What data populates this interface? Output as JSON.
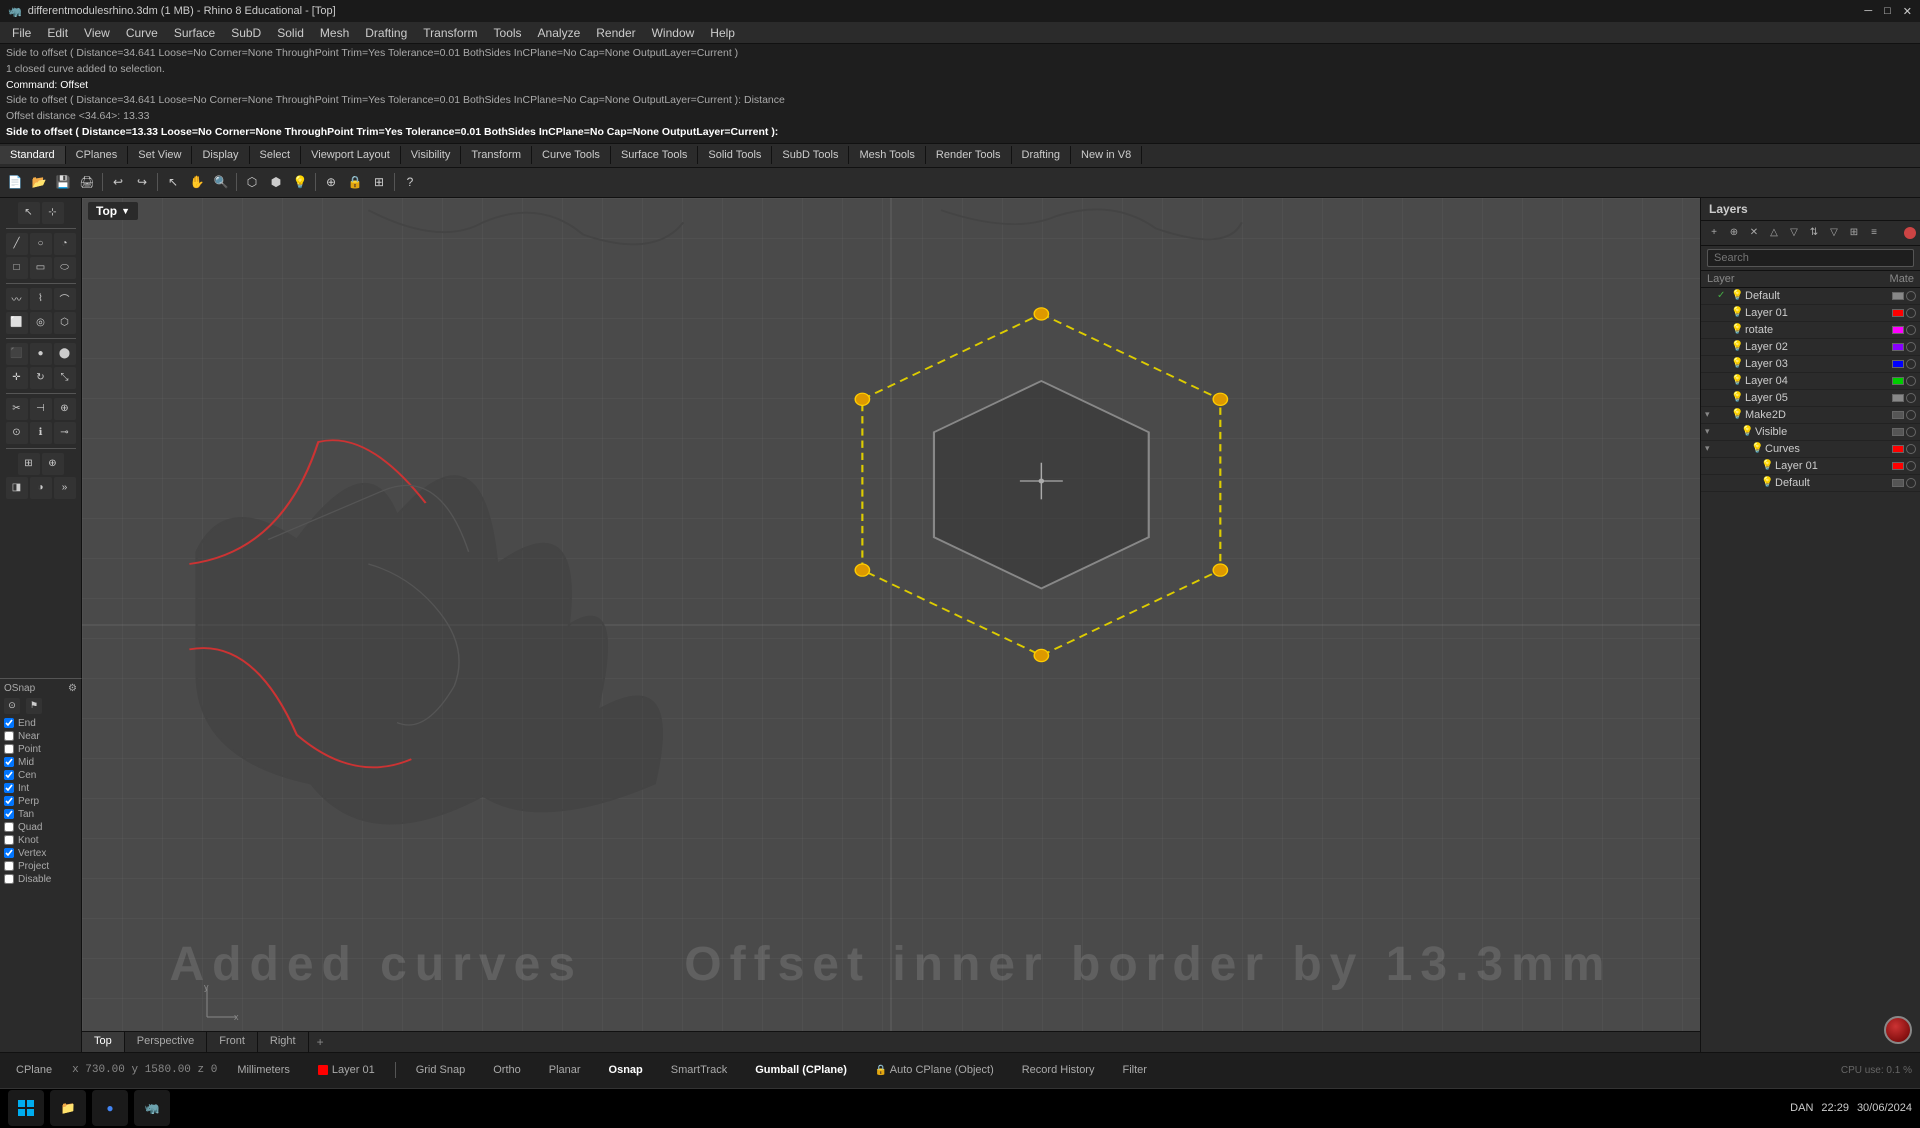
{
  "titlebar": {
    "title": "differentmodulesrhino.3dm (1 MB) - Rhino 8 Educational - [Top]",
    "icon": "🦏",
    "minimize": "─",
    "maximize": "□",
    "close": "✕"
  },
  "menu": {
    "items": [
      "File",
      "Edit",
      "View",
      "Curve",
      "Surface",
      "SubD",
      "Solid",
      "Mesh",
      "Drafting",
      "Transform",
      "Tools",
      "Analyze",
      "Render",
      "Window",
      "Help"
    ]
  },
  "command_area": {
    "line1": "Side to offset ( Distance=34.641  Loose=No  Corner=None  ThroughPoint  Trim=Yes  Tolerance=0.01  BothSides  InCPlane=No  Cap=None  OutputLayer=Current )",
    "line2": "1 closed curve added to selection.",
    "line3": "Command: Offset",
    "line4": "Side to offset ( Distance=34.641  Loose=No  Corner=None  ThroughPoint  Trim=Yes  Tolerance=0.01  BothSides  InCPlane=No  Cap=None  OutputLayer=Current ): Distance",
    "line5": "Offset distance <34.64>: 13.33",
    "line6": "Side to offset ( Distance=13.33  Loose=No  Corner=None  ThroughPoint  Trim=Yes  Tolerance=0.01  BothSides  InCPlane=No  Cap=None  OutputLayer=Current ):"
  },
  "toolbar_tabs": {
    "items": [
      "Standard",
      "CPlanes",
      "Set View",
      "Display",
      "Select",
      "Viewport Layout",
      "Visibility",
      "Transform",
      "Curve Tools",
      "Surface Tools",
      "Solid Tools",
      "SubD Tools",
      "Mesh Tools",
      "Render Tools",
      "Drafting",
      "New in V8"
    ]
  },
  "viewport": {
    "label": "Top",
    "watermark_left": "Added curves",
    "watermark_right": "Offset inner border by 13.3mm"
  },
  "view_tabs": {
    "items": [
      "Top",
      "Perspective",
      "Front",
      "Right"
    ],
    "active": "Top"
  },
  "layers_panel": {
    "title": "Layers",
    "search_placeholder": "Search",
    "col_layer": "Layer",
    "col_mate": "Mate",
    "layers": [
      {
        "name": "Default",
        "indent": 0,
        "checked": true,
        "color": "#888",
        "visible": true
      },
      {
        "name": "Layer 01",
        "indent": 0,
        "checked": false,
        "color": "#ff0000",
        "visible": true
      },
      {
        "name": "rotate",
        "indent": 0,
        "checked": false,
        "color": "#ff00ff",
        "visible": true
      },
      {
        "name": "Layer 02",
        "indent": 0,
        "checked": false,
        "color": "#8800ff",
        "visible": true
      },
      {
        "name": "Layer 03",
        "indent": 0,
        "checked": false,
        "color": "#0000ff",
        "visible": true
      },
      {
        "name": "Layer 04",
        "indent": 0,
        "checked": false,
        "color": "#00cc00",
        "visible": true
      },
      {
        "name": "Layer 05",
        "indent": 0,
        "checked": false,
        "color": "#888888",
        "visible": true
      },
      {
        "name": "Make2D",
        "indent": 0,
        "checked": false,
        "color": "#333333",
        "visible": true,
        "expanded": true
      },
      {
        "name": "Visible",
        "indent": 1,
        "checked": false,
        "color": "#333333",
        "visible": true,
        "expanded": true
      },
      {
        "name": "Curves",
        "indent": 2,
        "checked": false,
        "color": "#ff0000",
        "visible": true,
        "expanded": true
      },
      {
        "name": "Layer 01",
        "indent": 3,
        "checked": false,
        "color": "#ff0000",
        "visible": true
      },
      {
        "name": "Default",
        "indent": 3,
        "checked": false,
        "color": "#333333",
        "visible": true
      }
    ]
  },
  "osnap": {
    "title": "OSnap",
    "items": [
      {
        "name": "End",
        "checked": true
      },
      {
        "name": "Near",
        "checked": false
      },
      {
        "name": "Point",
        "checked": false
      },
      {
        "name": "Mid",
        "checked": true
      },
      {
        "name": "Cen",
        "checked": true
      },
      {
        "name": "Int",
        "checked": true
      },
      {
        "name": "Perp",
        "checked": true
      },
      {
        "name": "Tan",
        "checked": true
      },
      {
        "name": "Quad",
        "checked": false
      },
      {
        "name": "Knot",
        "checked": false
      },
      {
        "name": "Vertex",
        "checked": true
      },
      {
        "name": "Project",
        "checked": false
      },
      {
        "name": "Disable",
        "checked": false
      }
    ]
  },
  "statusbar": {
    "cplane": "CPlane",
    "coords": "x 730.00  y 1580.00  z 0",
    "units": "Millimeters",
    "layer": "Layer 01",
    "snap_items": [
      "Grid Snap",
      "Ortho",
      "Planar",
      "Osnap",
      "SmartTrack",
      "Gumball (CPlane)",
      "Auto CPlane (Object)",
      "Record History",
      "Filter"
    ],
    "cpu": "CPU use: 0.1 %"
  },
  "taskbar": {
    "time": "22:29",
    "date": "30/06/2024",
    "lang": "DAN"
  },
  "colors": {
    "background": "#4a4a4a",
    "hex_outer": "#dddd00",
    "hex_inner": "#333333",
    "curves_left": "#333333",
    "accent_red": "#cc3333"
  }
}
